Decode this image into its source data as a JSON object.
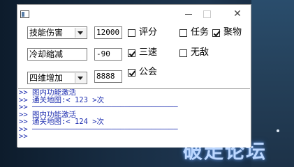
{
  "watermark": "破走论坛",
  "colors": {
    "log_text": "#1f2fb0",
    "window_bg": "#ffffff"
  },
  "titlebar": {
    "icon": "app-window-icon",
    "minimize_icon": "minimize-icon",
    "maximize_icon": "maximize-icon",
    "close_icon": "close-icon",
    "close_glyph": "✕"
  },
  "rows": [
    {
      "dropdown": "技能伤害",
      "number": "12000",
      "checks": [
        {
          "label": "评分",
          "checked": false
        },
        {
          "label": "任务",
          "checked": false
        },
        {
          "label": "聚物",
          "checked": true
        }
      ]
    },
    {
      "dropdown": "冷却缩减",
      "number": "-90",
      "checks": [
        {
          "label": "三速",
          "checked": true
        },
        {
          "label": "无敌",
          "checked": false
        }
      ]
    },
    {
      "dropdown": "四维增加",
      "number": "8888",
      "checks": [
        {
          "label": "公会",
          "checked": true
        }
      ]
    }
  ],
  "log": [
    ">> 图内功能激活",
    ">> 通关地图:< 123 >次",
    ">> ─────────────────────────────────",
    ">> 图内功能激活",
    ">> 通关地图:< 124 >次",
    ">> ─────────────────────────────────",
    ">>"
  ]
}
